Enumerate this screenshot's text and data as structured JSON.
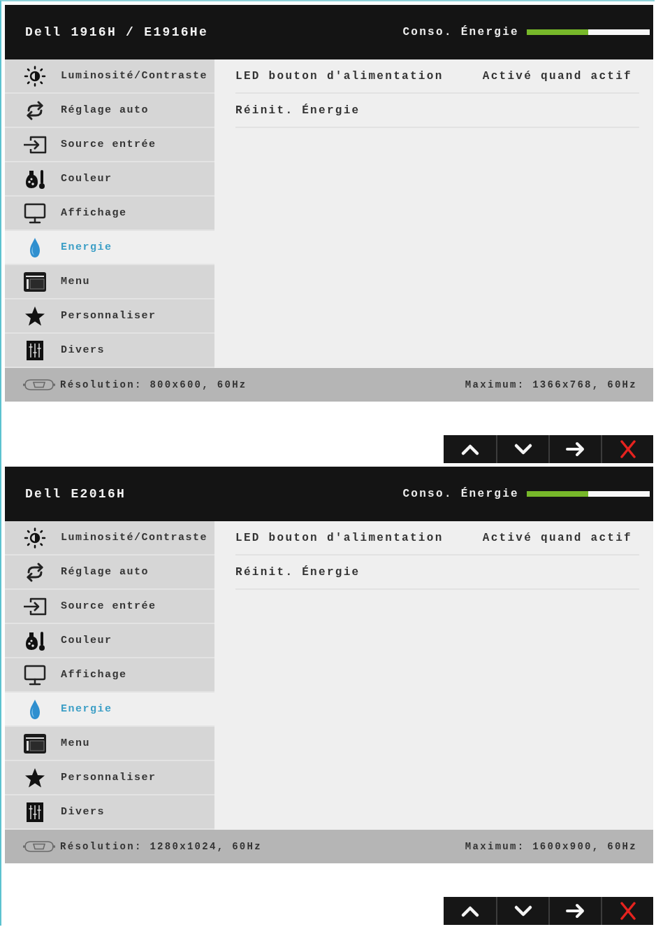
{
  "panels": [
    {
      "title": "Dell 1916H / E1916He",
      "power_meter": {
        "label": "Conso. Énergie",
        "level": 0.5
      },
      "menu": [
        {
          "label": "Luminosité/Contraste",
          "kind": "brightness",
          "selected": false
        },
        {
          "label": "Réglage auto",
          "kind": "auto",
          "selected": false
        },
        {
          "label": "Source entrée",
          "kind": "input",
          "selected": false
        },
        {
          "label": "Couleur",
          "kind": "color",
          "selected": false
        },
        {
          "label": "Affichage",
          "kind": "display",
          "selected": false
        },
        {
          "label": "Energie",
          "kind": "energy",
          "selected": true
        },
        {
          "label": "Menu",
          "kind": "menu",
          "selected": false
        },
        {
          "label": "Personnaliser",
          "kind": "personalize",
          "selected": false
        },
        {
          "label": "Divers",
          "kind": "others",
          "selected": false
        }
      ],
      "settings": [
        {
          "label": "LED bouton d'alimentation",
          "value": "Activé quand actif"
        },
        {
          "label": "Réinit. Énergie"
        }
      ],
      "status_bar": {
        "resolution": "Résolution: 800x600, 60Hz",
        "maximum": "Maximum: 1366x768, 60Hz"
      },
      "buttons": [
        {
          "kind": "up"
        },
        {
          "kind": "down"
        },
        {
          "kind": "enter"
        },
        {
          "kind": "exit"
        }
      ]
    },
    {
      "title": "Dell E2016H",
      "power_meter": {
        "label": "Conso. Énergie",
        "level": 0.5
      },
      "menu": [
        {
          "label": "Luminosité/Contraste",
          "kind": "brightness",
          "selected": false
        },
        {
          "label": "Réglage auto",
          "kind": "auto",
          "selected": false
        },
        {
          "label": "Source entrée",
          "kind": "input",
          "selected": false
        },
        {
          "label": "Couleur",
          "kind": "color",
          "selected": false
        },
        {
          "label": "Affichage",
          "kind": "display",
          "selected": false
        },
        {
          "label": "Energie",
          "kind": "energy",
          "selected": true
        },
        {
          "label": "Menu",
          "kind": "menu",
          "selected": false
        },
        {
          "label": "Personnaliser",
          "kind": "personalize",
          "selected": false
        },
        {
          "label": "Divers",
          "kind": "others",
          "selected": false
        }
      ],
      "settings": [
        {
          "label": "LED bouton d'alimentation",
          "value": "Activé quand actif"
        },
        {
          "label": "Réinit. Énergie"
        }
      ],
      "status_bar": {
        "resolution": "Résolution: 1280x1024, 60Hz",
        "maximum": "Maximum: 1600x900, 60Hz"
      },
      "buttons": [
        {
          "kind": "up"
        },
        {
          "kind": "down"
        },
        {
          "kind": "enter"
        },
        {
          "kind": "exit"
        }
      ]
    }
  ]
}
